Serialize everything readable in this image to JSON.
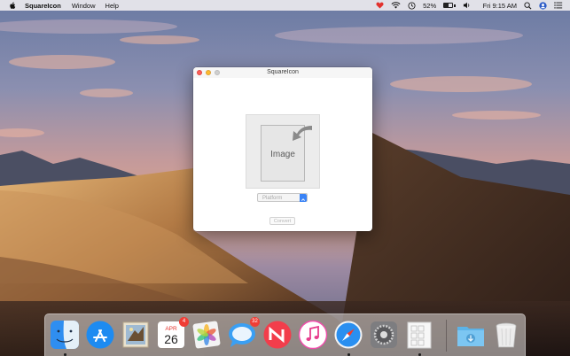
{
  "menubar": {
    "app_name": "SquareIcon",
    "menus": [
      "Window",
      "Help"
    ],
    "battery_percent": "52%",
    "battery_level": 0.52,
    "clock": "Fri 9:15 AM",
    "icons": [
      "apple-logo-icon",
      "status-heart-icon",
      "wifi-icon",
      "time-machine-icon",
      "battery-icon",
      "volume-icon",
      "spotlight-icon",
      "user-avatar-icon",
      "notification-center-icon"
    ]
  },
  "window": {
    "title": "SquareIcon",
    "drop_zone_label": "Image",
    "platform_placeholder": "Platform",
    "convert_label": "Convert"
  },
  "dock": {
    "apps": [
      {
        "name": "Finder",
        "icon": "finder-icon",
        "running": true
      },
      {
        "name": "App Store",
        "icon": "app-store-icon",
        "running": false
      },
      {
        "name": "Mail",
        "icon": "mail-icon",
        "running": false
      },
      {
        "name": "Calendar",
        "icon": "calendar-icon",
        "month": "APR",
        "day": "26",
        "badge": "4",
        "running": false
      },
      {
        "name": "Photos",
        "icon": "photos-icon",
        "running": false
      },
      {
        "name": "Messages",
        "icon": "messages-icon",
        "badge": "32",
        "running": false
      },
      {
        "name": "News",
        "icon": "news-icon",
        "running": false
      },
      {
        "name": "iTunes",
        "icon": "itunes-icon",
        "running": false
      },
      {
        "name": "Safari",
        "icon": "safari-icon",
        "running": true
      },
      {
        "name": "System Preferences",
        "icon": "system-preferences-icon",
        "running": false
      },
      {
        "name": "SquareIcon",
        "icon": "squareicon-app-icon",
        "running": true
      },
      {
        "name": "Downloads",
        "icon": "downloads-folder-icon",
        "running": false
      },
      {
        "name": "Trash",
        "icon": "trash-icon",
        "running": false
      }
    ]
  },
  "colors": {
    "close": "#fd5f57",
    "minimize": "#fdbc2e",
    "zoom": "#cfcfcf",
    "accent": "#3a83f6",
    "badge": "#f03d35"
  }
}
